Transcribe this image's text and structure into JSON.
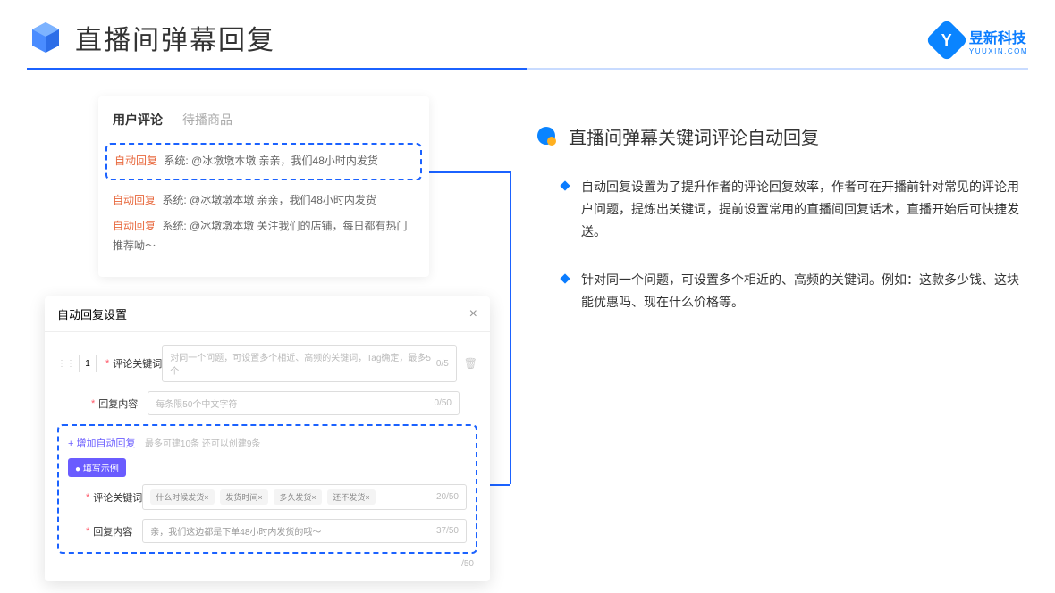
{
  "header": {
    "title": "直播间弹幕回复"
  },
  "brand": {
    "name": "昱新科技",
    "sub": "YUUXIN.COM"
  },
  "card1": {
    "tab1": "用户评论",
    "tab2": "待播商品",
    "auto_tag": "自动回复",
    "row1": "系统: @冰墩墩本墩 亲亲，我们48小时内发货",
    "row2": "系统: @冰墩墩本墩 亲亲，我们48小时内发货",
    "row3": "系统: @冰墩墩本墩 关注我们的店铺，每日都有热门推荐呦～"
  },
  "card2": {
    "title": "自动回复设置",
    "idx": "1",
    "label1": "评论关键词",
    "ph1": "对同一个问题，可设置多个相近、高频的关键词，Tag确定，最多5个",
    "cnt1": "0/5",
    "label2": "回复内容",
    "ph2": "每条限50个中文字符",
    "cnt2": "0/50",
    "add": "+ 增加自动回复",
    "add_note": "最多可建10条 还可以创建9条",
    "example_btn": "● 填写示例",
    "ex_label1": "评论关键词",
    "tags": [
      "什么时候发货×",
      "发货时间×",
      "多久发货×",
      "还不发货×"
    ],
    "ex_cnt1": "20/50",
    "ex_label2": "回复内容",
    "ex_text": "亲，我们这边都是下单48小时内发货的哦～",
    "ex_cnt2": "37/50",
    "foot_cnt": "/50"
  },
  "section": {
    "title": "直播间弹幕关键词评论自动回复",
    "bullet1": "自动回复设置为了提升作者的评论回复效率，作者可在开播前针对常见的评论用户问题，提炼出关键词，提前设置常用的直播间回复话术，直播开始后可快捷发送。",
    "bullet2": "针对同一个问题，可设置多个相近的、高频的关键词。例如：这款多少钱、这块能优惠吗、现在什么价格等。"
  }
}
